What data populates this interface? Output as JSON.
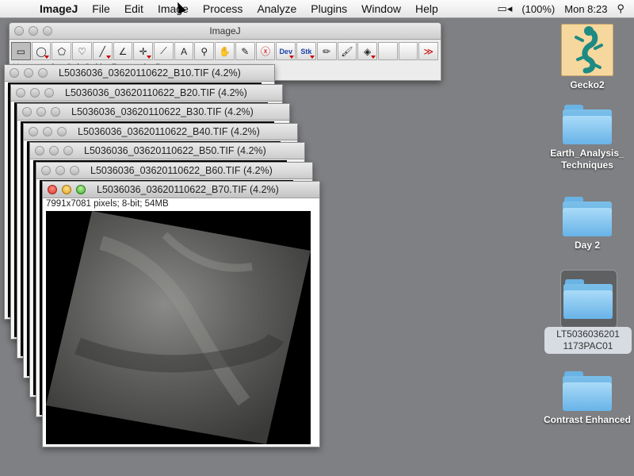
{
  "menubar": {
    "app": "ImageJ",
    "items": [
      "File",
      "Edit",
      "Image",
      "Process",
      "Analyze",
      "Plugins",
      "Window",
      "Help"
    ],
    "battery": "(100%)",
    "clock": "Mon 8:23"
  },
  "toolbar_window": {
    "title": "ImageJ",
    "status": "Hyperstacks, Gel, Gel by Rectangle, Dev",
    "tools": [
      {
        "name": "rectangle-tool",
        "glyph": "▭"
      },
      {
        "name": "oval-tool",
        "glyph": "◯"
      },
      {
        "name": "polygon-tool",
        "glyph": "⬠"
      },
      {
        "name": "freehand-tool",
        "glyph": "♡"
      },
      {
        "name": "line-tool",
        "glyph": "╱"
      },
      {
        "name": "angle-tool",
        "glyph": "∠"
      },
      {
        "name": "point-tool",
        "glyph": "✛"
      },
      {
        "name": "wand-tool",
        "glyph": "⟋"
      },
      {
        "name": "text-tool",
        "glyph": "A"
      },
      {
        "name": "magnifier-tool",
        "glyph": "⚲"
      },
      {
        "name": "hand-tool",
        "glyph": "✋"
      },
      {
        "name": "dropper-tool",
        "glyph": "✎"
      },
      {
        "name": "clear-tool",
        "glyph": "ⓧ"
      },
      {
        "name": "dev-tool",
        "glyph": "Dev"
      },
      {
        "name": "stack-tool",
        "glyph": "Stk"
      },
      {
        "name": "pencil-tool",
        "glyph": "✏"
      },
      {
        "name": "brush-tool",
        "glyph": "🖌"
      },
      {
        "name": "flood-fill-tool",
        "glyph": "◈"
      },
      {
        "name": "empty-tool-1",
        "glyph": ""
      },
      {
        "name": "empty-tool-2",
        "glyph": ""
      },
      {
        "name": "more-tools",
        "glyph": "≫"
      }
    ]
  },
  "image_windows": [
    {
      "title": "L5036036_03620110622_B10.TIF (4.2%)"
    },
    {
      "title": "L5036036_03620110622_B20.TIF (4.2%)"
    },
    {
      "title": "L5036036_03620110622_B30.TIF (4.2%)"
    },
    {
      "title": "L5036036_03620110622_B40.TIF (4.2%)"
    },
    {
      "title": "L5036036_03620110622_B50.TIF (4.2%)"
    },
    {
      "title": "L5036036_03620110622_B60.TIF (4.2%)"
    },
    {
      "title": "L5036036_03620110622_B70.TIF (4.2%)",
      "info": "7991x7081 pixels; 8-bit; 54MB"
    }
  ],
  "desktop": {
    "icons": [
      {
        "label": "Gecko2"
      },
      {
        "label": "Earth_Analysis_ Techniques"
      },
      {
        "label": "Day 2"
      },
      {
        "label": "LT5036036201 1173PAC01"
      },
      {
        "label": "Contrast Enhanced"
      }
    ]
  }
}
